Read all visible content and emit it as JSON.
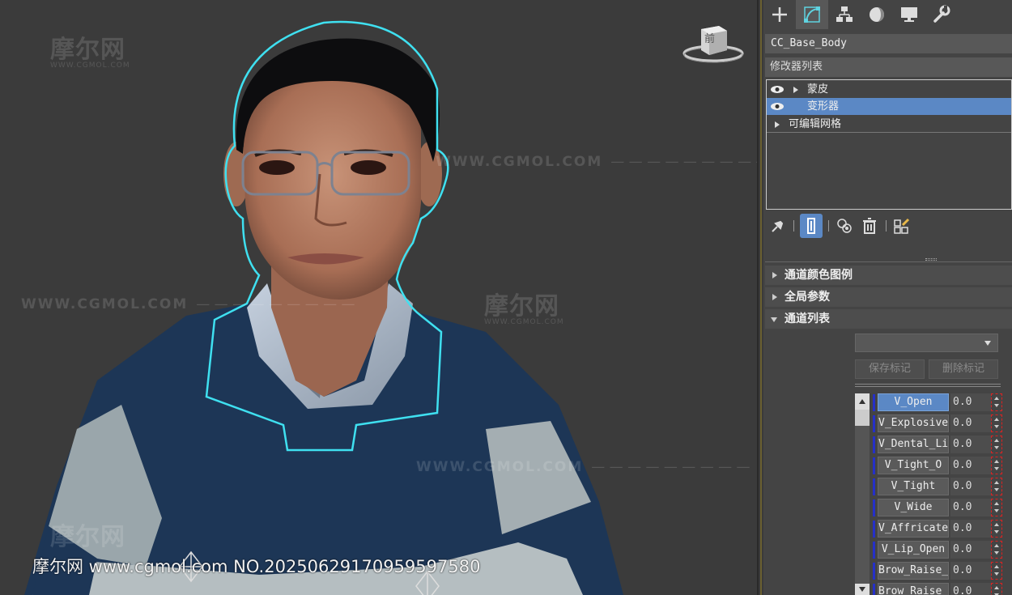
{
  "viewport": {
    "viewcube_label": "前",
    "watermarks": {
      "logo_text": "摩尔网",
      "logo_sub": "WWW.CGMOL.COM",
      "url_text": "WWW.CGMOL.COM"
    },
    "caption": "摩尔网 www.cgmol.com NO.20250629170959597580",
    "colors": {
      "selection_outline": "#3fe0f0",
      "sweater_navy": "#1d3656",
      "sweater_stripe": "#9aa6ab"
    }
  },
  "panel": {
    "tabs": [
      {
        "name": "create",
        "icon": "plus-icon"
      },
      {
        "name": "modify",
        "icon": "modify-curve-icon",
        "active": true
      },
      {
        "name": "hierarchy",
        "icon": "hierarchy-icon"
      },
      {
        "name": "motion",
        "icon": "motion-sphere-icon"
      },
      {
        "name": "display",
        "icon": "display-monitor-icon"
      },
      {
        "name": "utilities",
        "icon": "wrench-icon"
      }
    ],
    "object_name": "CC_Base_Body",
    "modifier_list_label": "修改器列表",
    "stack": [
      {
        "label": "蒙皮",
        "visible": true,
        "expandable": true,
        "selected": false
      },
      {
        "label": "变形器",
        "visible": true,
        "expandable": false,
        "selected": true
      },
      {
        "label": "可编辑网格",
        "visible": false,
        "expandable": true,
        "selected": false
      }
    ],
    "rollouts": {
      "channel_color_legend": "通道颜色图例",
      "global_params": "全局参数",
      "channel_list": "通道列表"
    },
    "marker_buttons": {
      "save": "保存标记",
      "delete": "删除标记"
    },
    "channels": [
      {
        "name": "V_Open",
        "value": "0.0"
      },
      {
        "name": "V_Explosive",
        "value": "0.0"
      },
      {
        "name": "V_Dental_Li",
        "value": "0.0"
      },
      {
        "name": "V_Tight_O",
        "value": "0.0"
      },
      {
        "name": "V_Tight",
        "value": "0.0"
      },
      {
        "name": "V_Wide",
        "value": "0.0"
      },
      {
        "name": "V_Affricate",
        "value": "0.0"
      },
      {
        "name": "V_Lip_Open",
        "value": "0.0"
      },
      {
        "name": "Brow_Raise_",
        "value": "0.0"
      },
      {
        "name": "Brow_Raise_",
        "value": "0.0"
      }
    ]
  }
}
